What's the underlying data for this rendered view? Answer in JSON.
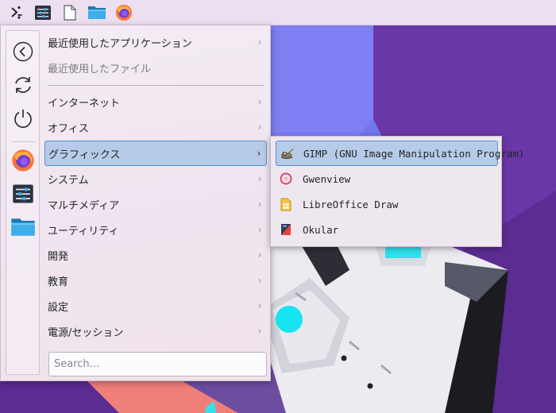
{
  "panel": {
    "items": [
      {
        "name": "application-launcher"
      },
      {
        "name": "system-settings"
      },
      {
        "name": "text-editor"
      },
      {
        "name": "file-manager"
      },
      {
        "name": "firefox"
      }
    ]
  },
  "sidebar": {
    "items": [
      {
        "name": "back-icon"
      },
      {
        "name": "restart-icon"
      },
      {
        "name": "shutdown-icon"
      },
      {
        "name": "firefox-icon"
      },
      {
        "name": "system-settings-icon"
      },
      {
        "name": "file-manager-icon"
      }
    ]
  },
  "menu": {
    "categories": [
      {
        "label": "最近使用したアプリケーション",
        "has_submenu": true
      },
      {
        "label": "最近使用したファイル",
        "disabled": true
      },
      {
        "label": "インターネット",
        "has_submenu": true
      },
      {
        "label": "オフィス",
        "has_submenu": true
      },
      {
        "label": "グラフィックス",
        "has_submenu": true,
        "active": true
      },
      {
        "label": "システム",
        "has_submenu": true
      },
      {
        "label": "マルチメディア",
        "has_submenu": true
      },
      {
        "label": "ユーティリティ",
        "has_submenu": true
      },
      {
        "label": "開発",
        "has_submenu": true
      },
      {
        "label": "教育",
        "has_submenu": true
      },
      {
        "label": "設定",
        "has_submenu": true
      },
      {
        "label": "電源/セッション",
        "has_submenu": true
      }
    ],
    "arrow_glyph": "›",
    "search_placeholder": "Search…"
  },
  "submenu": {
    "items": [
      {
        "label": "GIMP (GNU Image Manipulation Program)",
        "icon": "gimp-icon",
        "active": true
      },
      {
        "label": "Gwenview",
        "icon": "gwenview-icon"
      },
      {
        "label": "LibreOffice Draw",
        "icon": "libreoffice-draw-icon"
      },
      {
        "label": "Okular",
        "icon": "okular-icon"
      }
    ]
  },
  "colors": {
    "selection_fill": "#b6cbe8",
    "selection_border": "#5b8fd1",
    "panel_bg": "#ecdff0",
    "wallpaper_purple": "#5e2f96"
  }
}
